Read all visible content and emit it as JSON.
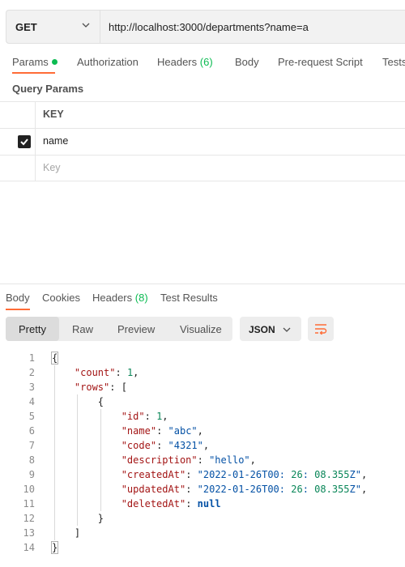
{
  "request": {
    "method": "GET",
    "url": "http://localhost:3000/departments?name=a"
  },
  "request_tabs": {
    "params": "Params",
    "authorization": "Authorization",
    "headers": "Headers",
    "headers_count": "(6)",
    "body": "Body",
    "prerequest": "Pre-request Script",
    "tests": "Tests"
  },
  "query_params": {
    "title": "Query Params",
    "key_header": "KEY",
    "rows": [
      {
        "checked": true,
        "key": "name"
      }
    ],
    "key_placeholder": "Key"
  },
  "response_tabs": {
    "body": "Body",
    "cookies": "Cookies",
    "headers": "Headers",
    "headers_count": "(8)",
    "test_results": "Test Results"
  },
  "view_modes": {
    "pretty": "Pretty",
    "raw": "Raw",
    "preview": "Preview",
    "visualize": "Visualize"
  },
  "format": "JSON",
  "response_lines": [
    "{",
    "    \"count\": 1,",
    "    \"rows\": [",
    "        {",
    "            \"id\": 1,",
    "            \"name\": \"abc\",",
    "            \"code\": \"4321\",",
    "            \"description\": \"hello\",",
    "            \"createdAt\": \"2022-01-26T00:26:08.355Z\",",
    "            \"updatedAt\": \"2022-01-26T00:26:08.355Z\",",
    "            \"deletedAt\": null",
    "        }",
    "    ]",
    "}"
  ],
  "colors": {
    "accent": "#ff6c37",
    "count_green": "#0cbb52",
    "json_key": "#a31515",
    "json_string": "#0451a5",
    "json_number": "#098658"
  }
}
